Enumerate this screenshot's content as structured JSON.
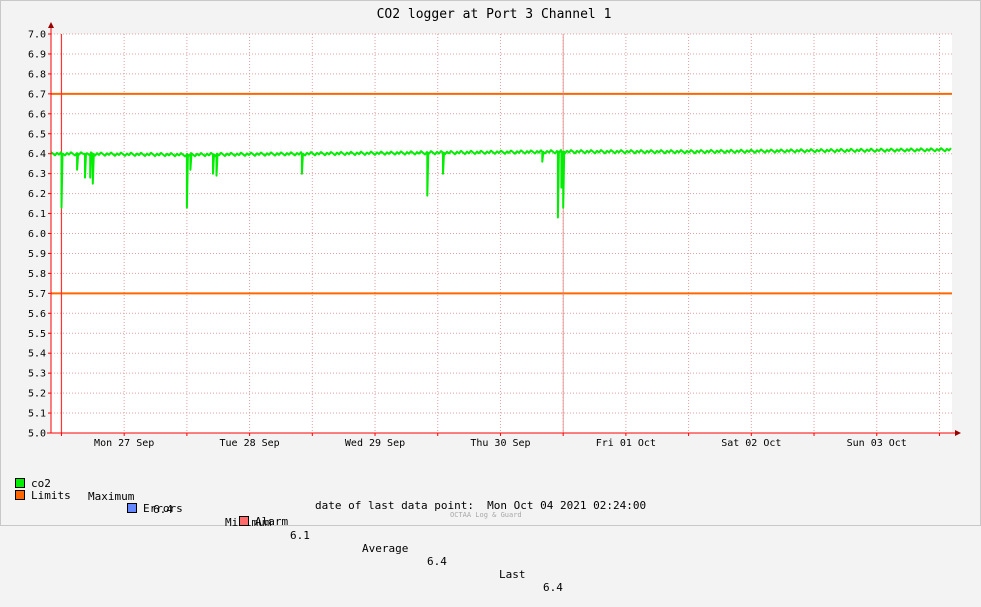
{
  "colors": {
    "background": "#f3f3f3",
    "plot_bg": "#ffffff",
    "grid": "#e0a0a0",
    "co2": "#00ee00",
    "limits": "#ff6600",
    "errors": "#6688ff",
    "alarm": "#ff6a6a",
    "alarm_line": "#ff3333",
    "axis": "#ff0000"
  },
  "chart_data": {
    "type": "line",
    "title": "CO2 logger at Port 3 Channel 1",
    "xlabel": "",
    "ylabel": "",
    "ylim": [
      5.0,
      7.0
    ],
    "yticks": [
      "7.0",
      "6.9",
      "6.8",
      "6.7",
      "6.6",
      "6.5",
      "6.4",
      "6.3",
      "6.2",
      "6.1",
      "6.0",
      "5.9",
      "5.8",
      "5.7",
      "5.6",
      "5.5",
      "5.4",
      "5.3",
      "5.2",
      "5.1",
      "5.0"
    ],
    "xlim_days": [
      "2021-09-26T22:00",
      "2021-10-04T02:24"
    ],
    "xticks": [
      "Mon 27 Sep",
      "Tue 28 Sep",
      "Wed 29 Sep",
      "Thu 30 Sep",
      "Fri 01 Oct",
      "Sat 02 Oct",
      "Sun 03 Oct"
    ],
    "grid": true,
    "limits": [
      6.7,
      5.7
    ],
    "alarm_marks": [
      "2021-09-27T00:00",
      "2021-10-01T00:00"
    ],
    "series": [
      {
        "name": "co2",
        "baseline": [
          [
            "2021-09-26T22:00",
            6.4
          ],
          [
            "2021-09-28T00:00",
            6.395
          ],
          [
            "2021-09-29T00:00",
            6.4
          ],
          [
            "2021-09-30T00:00",
            6.405
          ],
          [
            "2021-10-01T00:00",
            6.41
          ],
          [
            "2021-10-02T00:00",
            6.41
          ],
          [
            "2021-10-03T00:00",
            6.415
          ],
          [
            "2021-10-04T02:24",
            6.42
          ]
        ],
        "dips": [
          [
            "2021-09-27T00:00",
            6.13
          ],
          [
            "2021-09-27T03:00",
            6.32
          ],
          [
            "2021-09-27T04:30",
            6.28
          ],
          [
            "2021-09-27T05:30",
            6.28
          ],
          [
            "2021-09-27T06:00",
            6.25
          ],
          [
            "2021-09-28T00:00",
            6.13
          ],
          [
            "2021-09-28T00:40",
            6.32
          ],
          [
            "2021-09-28T05:00",
            6.3
          ],
          [
            "2021-09-28T05:40",
            6.29
          ],
          [
            "2021-09-28T22:00",
            6.3
          ],
          [
            "2021-09-29T22:00",
            6.19
          ],
          [
            "2021-09-30T01:00",
            6.3
          ],
          [
            "2021-09-30T20:00",
            6.36
          ],
          [
            "2021-09-30T23:00",
            6.08
          ],
          [
            "2021-09-30T23:40",
            6.23
          ],
          [
            "2021-10-01T00:00",
            6.13
          ]
        ]
      }
    ]
  },
  "legend": {
    "co2_label": "co2",
    "max_label": "Maximum",
    "max_value": "6.4",
    "min_label": "Minimum",
    "min_value": "6.1",
    "avg_label": "Average",
    "avg_value": "6.4",
    "last_label": "Last",
    "last_value": "6.4",
    "limits_label": "Limits",
    "errors_label": "Errors",
    "alarm_label": "Alarm"
  },
  "footer": {
    "last_point": "date of last data point:  Mon Oct 04 2021 02:24:00",
    "watermark": "OCTAA Log & Guard"
  }
}
